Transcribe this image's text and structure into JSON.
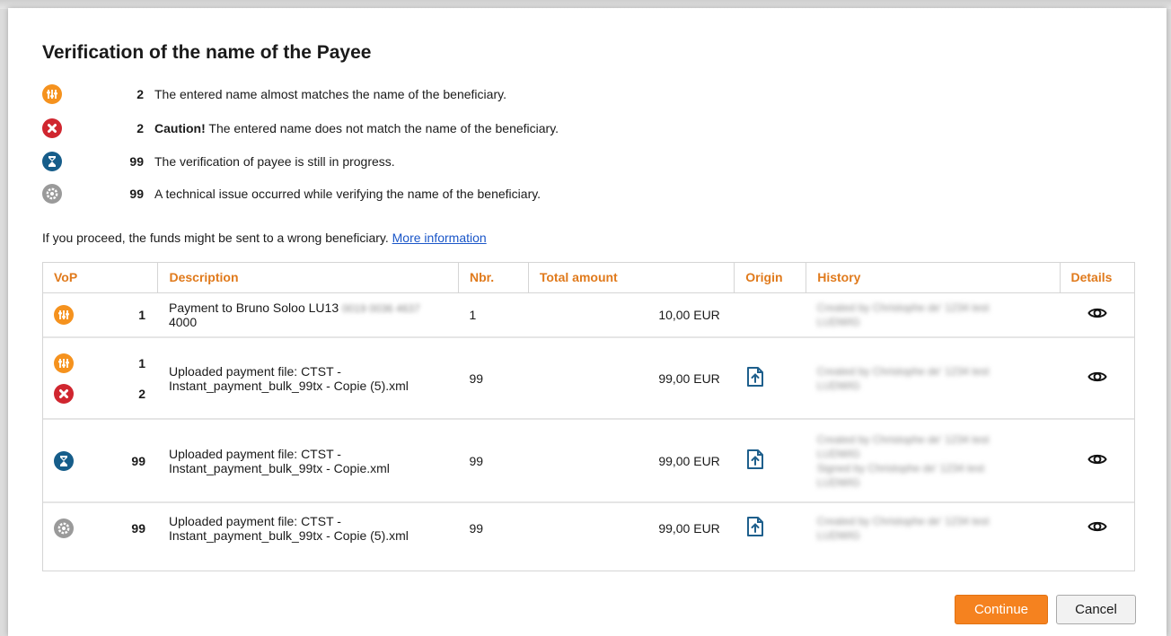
{
  "dialog": {
    "title": "Verification of the name of the Payee",
    "legend": [
      {
        "icon": "partial-match-icon",
        "count": "2",
        "bold_prefix": "",
        "text": "The entered name almost matches the name of the beneficiary."
      },
      {
        "icon": "no-match-icon",
        "count": "2",
        "bold_prefix": "Caution!",
        "text": " The entered name does not match the name of the beneficiary."
      },
      {
        "icon": "in-progress-icon",
        "count": "99",
        "bold_prefix": "",
        "text": "The verification of payee is still in progress."
      },
      {
        "icon": "technical-issue-icon",
        "count": "99",
        "bold_prefix": "",
        "text": "A technical issue occurred while verifying the name of the beneficiary."
      }
    ],
    "notice": {
      "text": "If you proceed, the funds might be sent to a wrong beneficiary.",
      "link": "More information"
    }
  },
  "table": {
    "headers": {
      "vop": "VoP",
      "description": "Description",
      "nbr": "Nbr.",
      "total_amount": "Total amount",
      "origin": "Origin",
      "history": "History",
      "details": "Details"
    },
    "rows": [
      {
        "vop": [
          {
            "icon": "partial-match-icon",
            "count": "1"
          }
        ],
        "description_line1": "Payment to Bruno Soloo LU13",
        "description_redacted": "0019 0036 4637",
        "description_line2": "4000",
        "nbr": "1",
        "amount": "10,00 EUR",
        "origin": "",
        "history": [
          "Created by Christophe de' 1234 test",
          "LUDWIG"
        ]
      },
      {
        "vop": [
          {
            "icon": "partial-match-icon",
            "count": "1"
          },
          {
            "icon": "no-match-icon",
            "count": "2"
          }
        ],
        "description_line1": "Uploaded payment file: CTST -",
        "description_line2": "Instant_payment_bulk_99tx - Copie (5).xml",
        "nbr": "99",
        "amount": "99,00 EUR",
        "origin": "upload-icon",
        "history": [
          "Created by Christophe de' 1234 test",
          "LUDWIG"
        ]
      },
      {
        "vop": [
          {
            "icon": "in-progress-icon",
            "count": "99"
          }
        ],
        "description_line1": "Uploaded payment file: CTST -",
        "description_line2": "Instant_payment_bulk_99tx - Copie.xml",
        "nbr": "99",
        "amount": "99,00 EUR",
        "origin": "upload-icon",
        "history": [
          "Created by Christophe de' 1234 test",
          "LUDWIG",
          "Signed by Christophe de' 1234 test",
          "LUDWIG"
        ]
      },
      {
        "vop": [
          {
            "icon": "technical-issue-icon",
            "count": "99"
          }
        ],
        "description_line1": "Uploaded payment file: CTST -",
        "description_line2": "Instant_payment_bulk_99tx - Copie (5).xml",
        "nbr": "99",
        "amount": "99,00 EUR",
        "origin": "upload-icon",
        "history": [
          "Created by Christophe de' 1234 test",
          "LUDWIG"
        ]
      }
    ]
  },
  "buttons": {
    "continue": "Continue",
    "cancel": "Cancel"
  },
  "colors": {
    "accent": "#f5821f",
    "header_text": "#e07a1c",
    "link": "#1a56c8",
    "partial_match": "#f5921e",
    "no_match": "#d0262f",
    "in_progress": "#165d8a",
    "technical_issue": "#9a9a9a"
  }
}
